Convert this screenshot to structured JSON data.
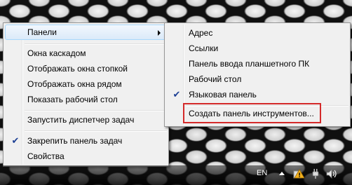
{
  "main_menu": {
    "toolbars": "Панели",
    "cascade": "Окна каскадом",
    "stacked": "Отображать окна стопкой",
    "side_by_side": "Отображать окна рядом",
    "show_desktop": "Показать рабочий стол",
    "task_manager": "Запустить диспетчер задач",
    "lock_taskbar": "Закрепить панель задач",
    "properties": "Свойства"
  },
  "submenu": {
    "address": "Адрес",
    "links": "Ссылки",
    "tablet_input": "Панель ввода планшетного ПК",
    "desktop": "Рабочий стол",
    "language_bar": "Языковая панель",
    "new_toolbar": "Создать панель инструментов..."
  },
  "tray": {
    "language": "EN"
  },
  "colors": {
    "highlight_box": "#d42a2a",
    "checkmark": "#1c3f94"
  },
  "icons": [
    "checkmark-icon",
    "submenu-arrow-icon",
    "tray-overflow-arrow-icon",
    "action-center-warning-icon",
    "power-plug-icon",
    "volume-icon"
  ]
}
